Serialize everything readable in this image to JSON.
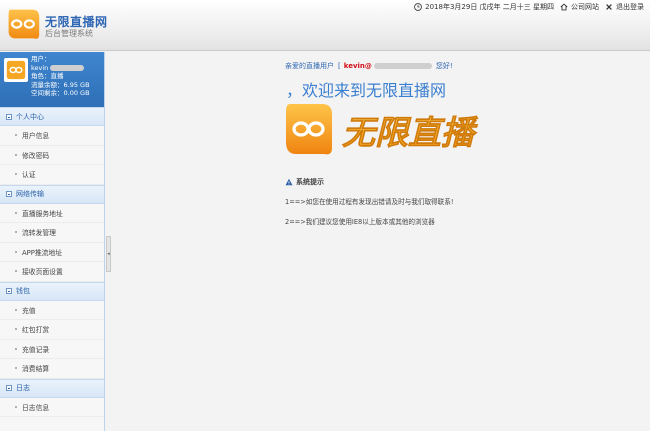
{
  "header": {
    "title": "无限直播网",
    "subtitle": "后台管理系统",
    "date": "2018年3月29日 戊戌年 二月十三 星期四",
    "home_link": "公司网站",
    "logout": "退出登录"
  },
  "user": {
    "label_user": "用户：",
    "username": "kevin",
    "label_role": "角色：",
    "role": "直播",
    "label_traffic": "流量余额：",
    "traffic": "6.95 GB",
    "label_space": "空间剩余：",
    "space": "0.00 GB"
  },
  "sidebar": {
    "groups": [
      {
        "title": "个人中心",
        "items": [
          "用户信息",
          "修改密码",
          "认证"
        ]
      },
      {
        "title": "网络传输",
        "items": [
          "直播服务地址",
          "流转发管理",
          "APP推流地址",
          "接收页面设置"
        ]
      },
      {
        "title": "钱包",
        "items": [
          "充值",
          "红包打赏",
          "充值记录",
          "消费结算"
        ]
      },
      {
        "title": "日志",
        "items": [
          "日志信息"
        ]
      }
    ]
  },
  "main": {
    "greeting_prefix": "亲爱的直播用户",
    "greeting_bracket": "[",
    "greeting_user": "kevin@",
    "greeting_suffix": "您好!",
    "welcome": "，欢迎来到无限直播网",
    "logo_text": "无限直播",
    "notice_title": "系统提示",
    "notices": [
      "1==>如您在使用过程有发现出错请及时与我们取得联系!",
      "2==>我们建议您使用IE8以上版本或其他的浏览器"
    ]
  },
  "colors": {
    "brand_blue": "#2f67b4",
    "logo_orange": "#f5a623",
    "user_red": "#d0101b",
    "sidebar_header_bg": "#dbe8f6"
  },
  "icons": {
    "date": "clock-icon",
    "home": "home-icon",
    "logout": "close-icon",
    "notice": "warning-icon",
    "logo": "infinity-icon"
  }
}
